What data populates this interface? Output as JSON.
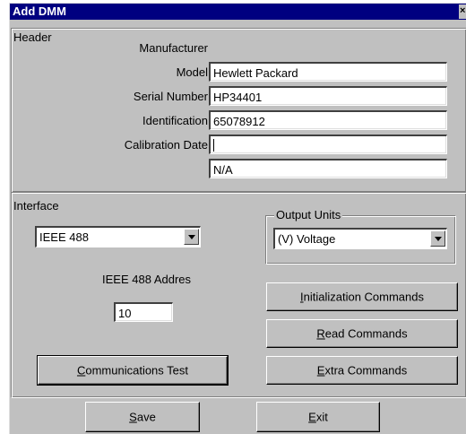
{
  "window": {
    "title": "Add DMM",
    "close_glyph": "×"
  },
  "header": {
    "label": "Header",
    "fields": [
      {
        "label": "Manufacturer",
        "value": "Hewlett Packard"
      },
      {
        "label": "Model",
        "value": "HP34401"
      },
      {
        "label": "Serial Number",
        "value": "65078912"
      },
      {
        "label": "Identification",
        "value": ""
      },
      {
        "label": "Calibration Date",
        "value": "N/A"
      }
    ]
  },
  "interface": {
    "label": "Interface",
    "selected": "IEEE 488",
    "address_label": "IEEE 488 Addres",
    "address_value": "10"
  },
  "output_units": {
    "label": "Output Units",
    "selected": "(V) Voltage"
  },
  "buttons": {
    "init_key": "I",
    "init_rest": "nitialization Commands",
    "read_key": "R",
    "read_rest": "ead Commands",
    "extra_key": "E",
    "extra_rest": "xtra Commands",
    "comm_key": "C",
    "comm_rest": "ommunications Test",
    "save_key": "S",
    "save_rest": "ave",
    "exit_key": "E",
    "exit_rest": "xit"
  },
  "icons": {
    "close": "close-icon",
    "dropdown": "chevron-down-icon"
  }
}
